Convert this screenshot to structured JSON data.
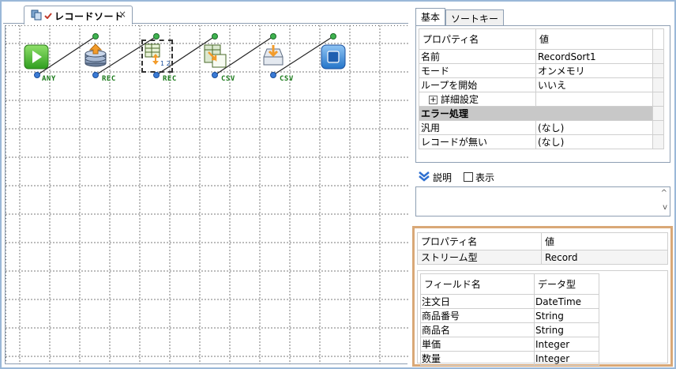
{
  "editor": {
    "tab_label": "レコードソート",
    "close_glyph": "×",
    "components": [
      {
        "name": "start",
        "label": "ANY"
      },
      {
        "name": "rec-input",
        "label": "REC"
      },
      {
        "name": "record-sort",
        "label": "REC"
      },
      {
        "name": "csv-output",
        "label": "CSV"
      },
      {
        "name": "csv-write",
        "label": "CSV"
      },
      {
        "name": "end",
        "label": ""
      }
    ]
  },
  "properties": {
    "tabs": [
      "基本",
      "ソートキー"
    ],
    "header": {
      "name": "プロパティ名",
      "value": "値"
    },
    "rows": [
      {
        "name": "名前",
        "value": "RecordSort1"
      },
      {
        "name": "モード",
        "value": "オンメモリ"
      },
      {
        "name": "ループを開始",
        "value": "いいえ"
      },
      {
        "name": "詳細設定",
        "value": ""
      }
    ],
    "expander_glyph": "+",
    "group": "エラー処理",
    "error_rows": [
      {
        "name": "汎用",
        "value": "(なし)"
      },
      {
        "name": "レコードが無い",
        "value": "(なし)"
      }
    ]
  },
  "description": {
    "label": "説明",
    "checkbox_label": "表示",
    "scroll_up": "^",
    "scroll_down": "v"
  },
  "stream": {
    "header": {
      "name": "プロパティ名",
      "value": "値"
    },
    "type_label": "ストリーム型",
    "type_value": "Record",
    "field_header": {
      "name": "フィールド名",
      "type": "データ型"
    },
    "fields": [
      {
        "name": "注文日",
        "type": "DateTime"
      },
      {
        "name": "商品番号",
        "type": "String"
      },
      {
        "name": "商品名",
        "type": "String"
      },
      {
        "name": "単価",
        "type": "Integer"
      },
      {
        "name": "数量",
        "type": "Integer"
      }
    ]
  },
  "colors": {
    "accent": "#9ab8d8",
    "panel_border": "#d9a877",
    "port_label": "#1a7a1a"
  }
}
